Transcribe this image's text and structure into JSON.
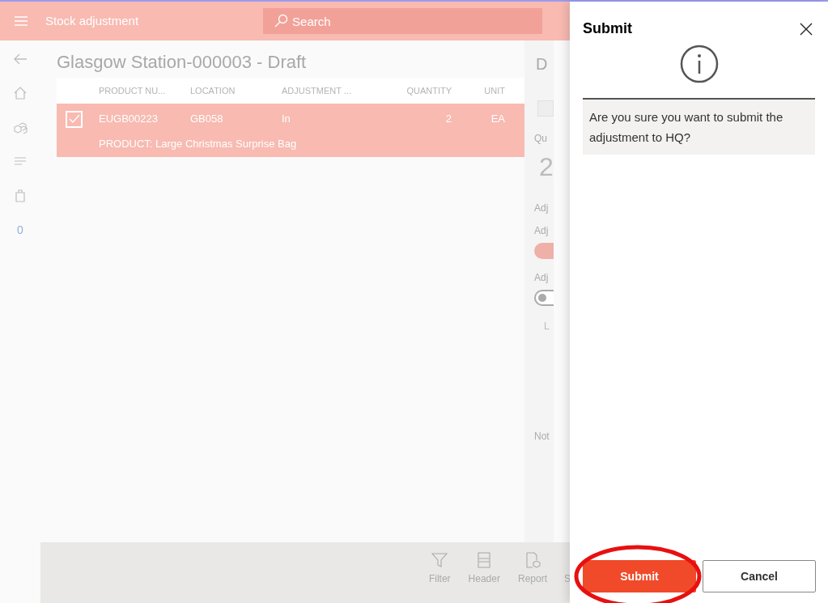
{
  "app_bar": {
    "title": "Stock adjustment",
    "search": {
      "placeholder": "Search"
    }
  },
  "nav_rail": {
    "count": "0"
  },
  "page": {
    "title": "Glasgow Station-000003 - Draft"
  },
  "table": {
    "columns": [
      "PRODUCT NU...",
      "LOCATION",
      "ADJUSTMENT ...",
      "QUANTITY",
      "UNIT"
    ],
    "rows": [
      {
        "selected": true,
        "checked": true,
        "cells": [
          "EUGB00223",
          "GB058",
          "In",
          "2",
          "EA"
        ],
        "detail": "PRODUCT: Large Christmas Surprise Bag"
      }
    ]
  },
  "details_panel": {
    "title": "D",
    "fields": [
      {
        "kind": "checkbox",
        "checked": false
      },
      {
        "kind": "label",
        "text": "Qu"
      },
      {
        "kind": "value",
        "text": "2"
      },
      {
        "kind": "label",
        "text": "Adj"
      },
      {
        "kind": "label",
        "text": "Adj"
      },
      {
        "kind": "toggle",
        "on": true
      },
      {
        "kind": "label",
        "text": "Adj"
      },
      {
        "kind": "toggle",
        "on": false
      },
      {
        "kind": "sub",
        "text": "L"
      },
      {
        "kind": "label",
        "text": "Not"
      }
    ]
  },
  "toolbar": [
    "Filter",
    "Header",
    "Report",
    "S"
  ],
  "dialog": {
    "title": "Submit",
    "message": "Are you sure you want to submit the adjustment to HQ?",
    "buttons": [
      {
        "label": "Submit",
        "primary": true,
        "highlighted": true
      },
      {
        "label": "Cancel",
        "primary": false,
        "highlighted": false
      }
    ]
  }
}
